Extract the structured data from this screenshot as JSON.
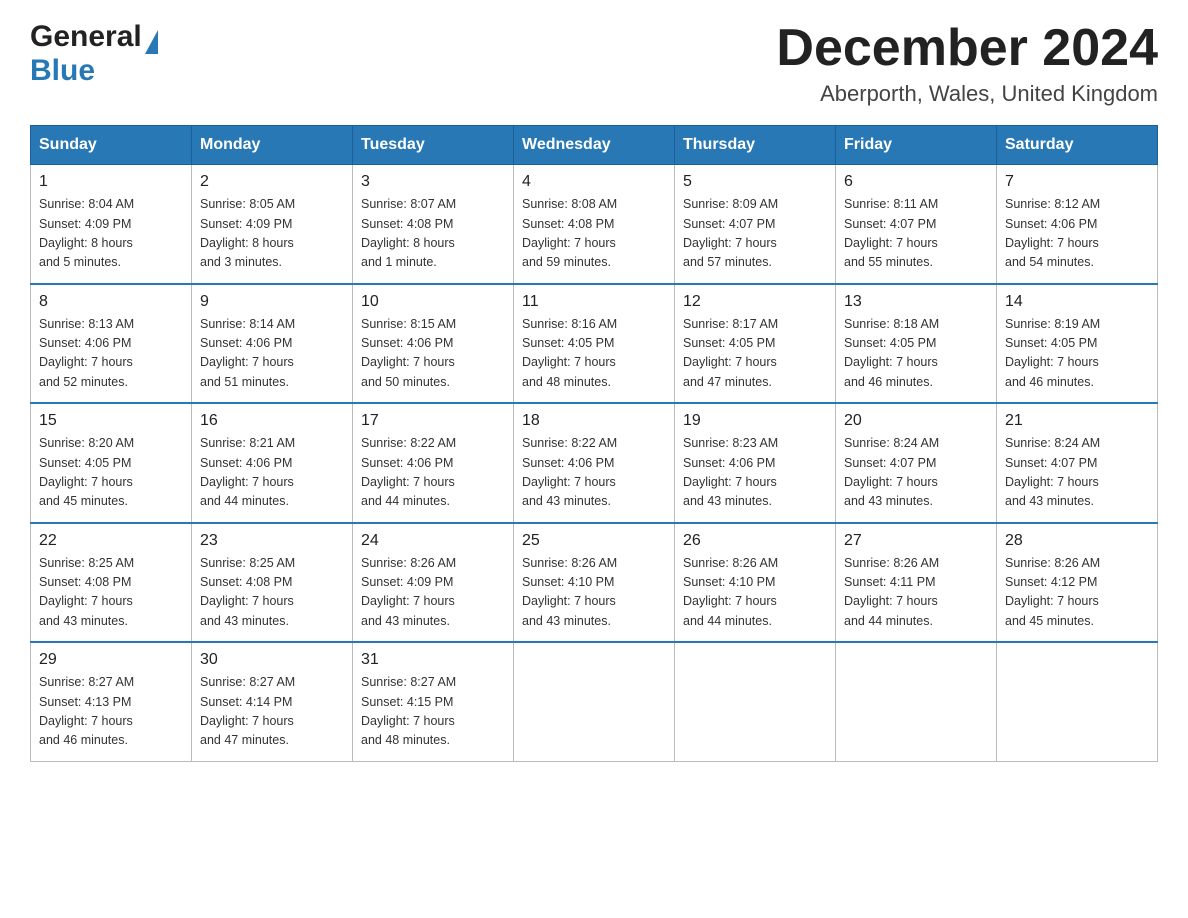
{
  "header": {
    "logo_general": "General",
    "logo_blue": "Blue",
    "month_title": "December 2024",
    "location": "Aberporth, Wales, United Kingdom"
  },
  "weekdays": [
    "Sunday",
    "Monday",
    "Tuesday",
    "Wednesday",
    "Thursday",
    "Friday",
    "Saturday"
  ],
  "weeks": [
    [
      {
        "day": "1",
        "info": "Sunrise: 8:04 AM\nSunset: 4:09 PM\nDaylight: 8 hours\nand 5 minutes."
      },
      {
        "day": "2",
        "info": "Sunrise: 8:05 AM\nSunset: 4:09 PM\nDaylight: 8 hours\nand 3 minutes."
      },
      {
        "day": "3",
        "info": "Sunrise: 8:07 AM\nSunset: 4:08 PM\nDaylight: 8 hours\nand 1 minute."
      },
      {
        "day": "4",
        "info": "Sunrise: 8:08 AM\nSunset: 4:08 PM\nDaylight: 7 hours\nand 59 minutes."
      },
      {
        "day": "5",
        "info": "Sunrise: 8:09 AM\nSunset: 4:07 PM\nDaylight: 7 hours\nand 57 minutes."
      },
      {
        "day": "6",
        "info": "Sunrise: 8:11 AM\nSunset: 4:07 PM\nDaylight: 7 hours\nand 55 minutes."
      },
      {
        "day": "7",
        "info": "Sunrise: 8:12 AM\nSunset: 4:06 PM\nDaylight: 7 hours\nand 54 minutes."
      }
    ],
    [
      {
        "day": "8",
        "info": "Sunrise: 8:13 AM\nSunset: 4:06 PM\nDaylight: 7 hours\nand 52 minutes."
      },
      {
        "day": "9",
        "info": "Sunrise: 8:14 AM\nSunset: 4:06 PM\nDaylight: 7 hours\nand 51 minutes."
      },
      {
        "day": "10",
        "info": "Sunrise: 8:15 AM\nSunset: 4:06 PM\nDaylight: 7 hours\nand 50 minutes."
      },
      {
        "day": "11",
        "info": "Sunrise: 8:16 AM\nSunset: 4:05 PM\nDaylight: 7 hours\nand 48 minutes."
      },
      {
        "day": "12",
        "info": "Sunrise: 8:17 AM\nSunset: 4:05 PM\nDaylight: 7 hours\nand 47 minutes."
      },
      {
        "day": "13",
        "info": "Sunrise: 8:18 AM\nSunset: 4:05 PM\nDaylight: 7 hours\nand 46 minutes."
      },
      {
        "day": "14",
        "info": "Sunrise: 8:19 AM\nSunset: 4:05 PM\nDaylight: 7 hours\nand 46 minutes."
      }
    ],
    [
      {
        "day": "15",
        "info": "Sunrise: 8:20 AM\nSunset: 4:05 PM\nDaylight: 7 hours\nand 45 minutes."
      },
      {
        "day": "16",
        "info": "Sunrise: 8:21 AM\nSunset: 4:06 PM\nDaylight: 7 hours\nand 44 minutes."
      },
      {
        "day": "17",
        "info": "Sunrise: 8:22 AM\nSunset: 4:06 PM\nDaylight: 7 hours\nand 44 minutes."
      },
      {
        "day": "18",
        "info": "Sunrise: 8:22 AM\nSunset: 4:06 PM\nDaylight: 7 hours\nand 43 minutes."
      },
      {
        "day": "19",
        "info": "Sunrise: 8:23 AM\nSunset: 4:06 PM\nDaylight: 7 hours\nand 43 minutes."
      },
      {
        "day": "20",
        "info": "Sunrise: 8:24 AM\nSunset: 4:07 PM\nDaylight: 7 hours\nand 43 minutes."
      },
      {
        "day": "21",
        "info": "Sunrise: 8:24 AM\nSunset: 4:07 PM\nDaylight: 7 hours\nand 43 minutes."
      }
    ],
    [
      {
        "day": "22",
        "info": "Sunrise: 8:25 AM\nSunset: 4:08 PM\nDaylight: 7 hours\nand 43 minutes."
      },
      {
        "day": "23",
        "info": "Sunrise: 8:25 AM\nSunset: 4:08 PM\nDaylight: 7 hours\nand 43 minutes."
      },
      {
        "day": "24",
        "info": "Sunrise: 8:26 AM\nSunset: 4:09 PM\nDaylight: 7 hours\nand 43 minutes."
      },
      {
        "day": "25",
        "info": "Sunrise: 8:26 AM\nSunset: 4:10 PM\nDaylight: 7 hours\nand 43 minutes."
      },
      {
        "day": "26",
        "info": "Sunrise: 8:26 AM\nSunset: 4:10 PM\nDaylight: 7 hours\nand 44 minutes."
      },
      {
        "day": "27",
        "info": "Sunrise: 8:26 AM\nSunset: 4:11 PM\nDaylight: 7 hours\nand 44 minutes."
      },
      {
        "day": "28",
        "info": "Sunrise: 8:26 AM\nSunset: 4:12 PM\nDaylight: 7 hours\nand 45 minutes."
      }
    ],
    [
      {
        "day": "29",
        "info": "Sunrise: 8:27 AM\nSunset: 4:13 PM\nDaylight: 7 hours\nand 46 minutes."
      },
      {
        "day": "30",
        "info": "Sunrise: 8:27 AM\nSunset: 4:14 PM\nDaylight: 7 hours\nand 47 minutes."
      },
      {
        "day": "31",
        "info": "Sunrise: 8:27 AM\nSunset: 4:15 PM\nDaylight: 7 hours\nand 48 minutes."
      },
      null,
      null,
      null,
      null
    ]
  ]
}
